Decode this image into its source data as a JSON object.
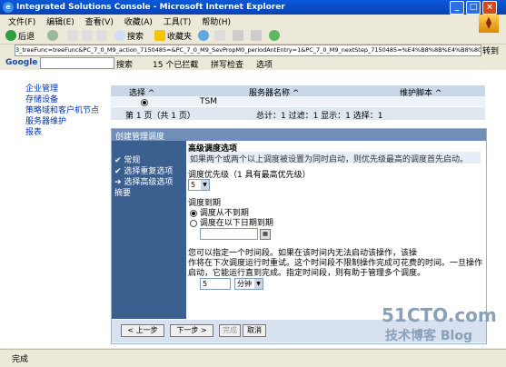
{
  "window": {
    "title": "Integrated Solutions Console - Microsoft Internet Explorer",
    "minimize": "_",
    "maximize": "□",
    "close": "×"
  },
  "menu": [
    "文件(F)",
    "编辑(E)",
    "查看(V)",
    "收藏(A)",
    "工具(T)",
    "帮助(H)"
  ],
  "toolbar": {
    "back": "后退",
    "search": "搜索",
    "favorites": "收藏夹"
  },
  "address": {
    "value": "3_treeFunc=treeFunc&PC_7_0_M9_action_7150485=&PC_7_0_M9_SevPropM0_periodAntEntry=1&PC_7_0_M9_nextStep_7150485=%E4%B8%8B%E4%B8%80%E6%AD%A5+%3E",
    "go": "转到"
  },
  "google": {
    "label": "Google -",
    "search_btn": "搜索",
    "blocked": "15 个已拦截",
    "spellcheck": "拼写检查",
    "options": "选项"
  },
  "left_nav": [
    "企业管理",
    "存储设备",
    "策略域和客户机节点",
    "服务器维护",
    "报表"
  ],
  "server_table": {
    "headers": [
      "选择 ^",
      "服务器名称 ^",
      "维护脚本 ^"
    ],
    "rows": [
      {
        "server": "TSM"
      }
    ],
    "page": "第 1 页（共 1 页）",
    "summary": "总计：1  过滤：1  显示：1  选择：1"
  },
  "wizard": {
    "title": "创建管理调度",
    "steps": [
      "✔ 常规",
      "✔ 选择重复选项",
      "➜ 选择高级选项",
      "   摘要"
    ],
    "section_title": "高级调度选项",
    "section_desc": "如果两个或两个以上调度被设置为同时启动，则优先级最高的调度首先启动。",
    "priority_label": "调度优先级（1 具有最高优先级）",
    "priority_value": "5",
    "expiry_label": "调度到期",
    "expiry_never": "调度从不到期",
    "expiry_after": "调度在以下日期到期",
    "info_text_1": "您可以指定一个时间段。如果在该时间内无法启动该操作，该操",
    "info_text_2": "作将在下次调度运行时重试。这个时间段不限制操作完成可花费的时间。一旦操作",
    "info_text_3": "启动，它能运行直到完成。指定时间段，则有助于管理多个调度。",
    "duration_value": "5",
    "duration_unit": "分钟",
    "buttons": {
      "back": "< 上一步",
      "next": "下一步 >",
      "finish": "完成",
      "cancel": "取消"
    }
  },
  "status": {
    "text": "完成"
  },
  "watermark": {
    "site": "51CTO.com",
    "blog": "技术博客  Blog"
  }
}
